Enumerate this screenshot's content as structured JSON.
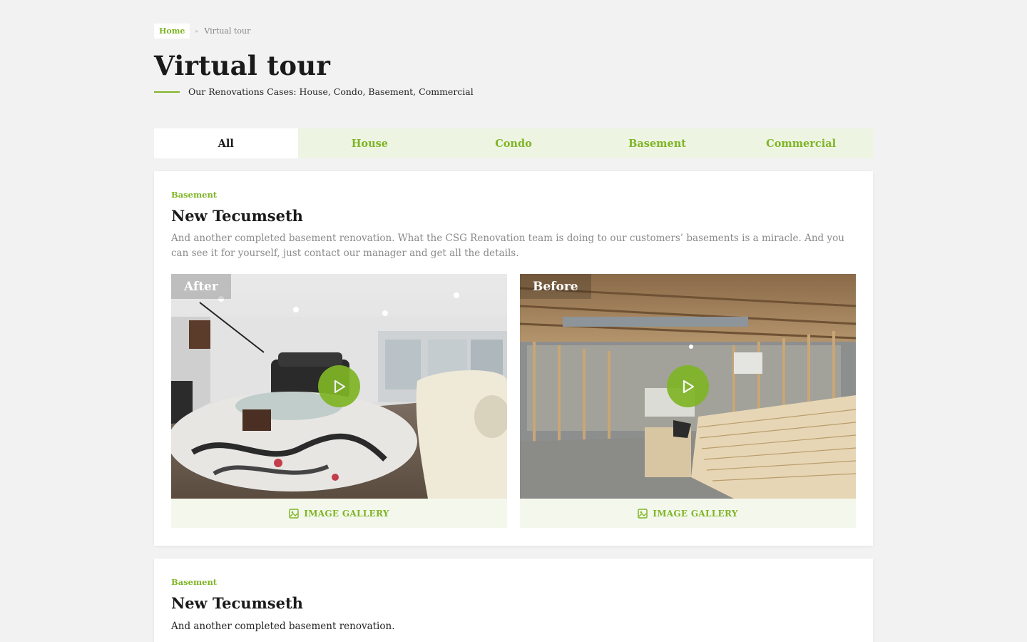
{
  "breadcrumb": {
    "home": "Home",
    "current": "Virtual tour"
  },
  "page": {
    "title": "Virtual tour",
    "subtitle": "Our Renovations Cases: House, Condo, Basement, Commercial"
  },
  "tabs": [
    {
      "label": "All",
      "active": true
    },
    {
      "label": "House",
      "active": false
    },
    {
      "label": "Condo",
      "active": false
    },
    {
      "label": "Basement",
      "active": false
    },
    {
      "label": "Commercial",
      "active": false
    }
  ],
  "cards": [
    {
      "tag": "Basement",
      "title": "New Tecumseth",
      "description": "And another completed basement renovation. What the CSG Renovation team is doing to our customers’ basements is a miracle. And you can see it for yourself, just contact our manager and get all the details.",
      "media": [
        {
          "label": "After",
          "gallery_label": "IMAGE GALLERY",
          "play_icon": "play-icon",
          "gallery_icon": "image-icon"
        },
        {
          "label": "Before",
          "gallery_label": "IMAGE GALLERY",
          "play_icon": "play-icon",
          "gallery_icon": "image-icon"
        }
      ]
    },
    {
      "tag": "Basement",
      "title": "New Tecumseth",
      "description": "And another completed basement renovation."
    }
  ],
  "colors": {
    "accent": "#7fb526",
    "background": "#f2f2f2",
    "tab_background": "#eef4e2",
    "gallery_background": "#f4f8ec"
  }
}
